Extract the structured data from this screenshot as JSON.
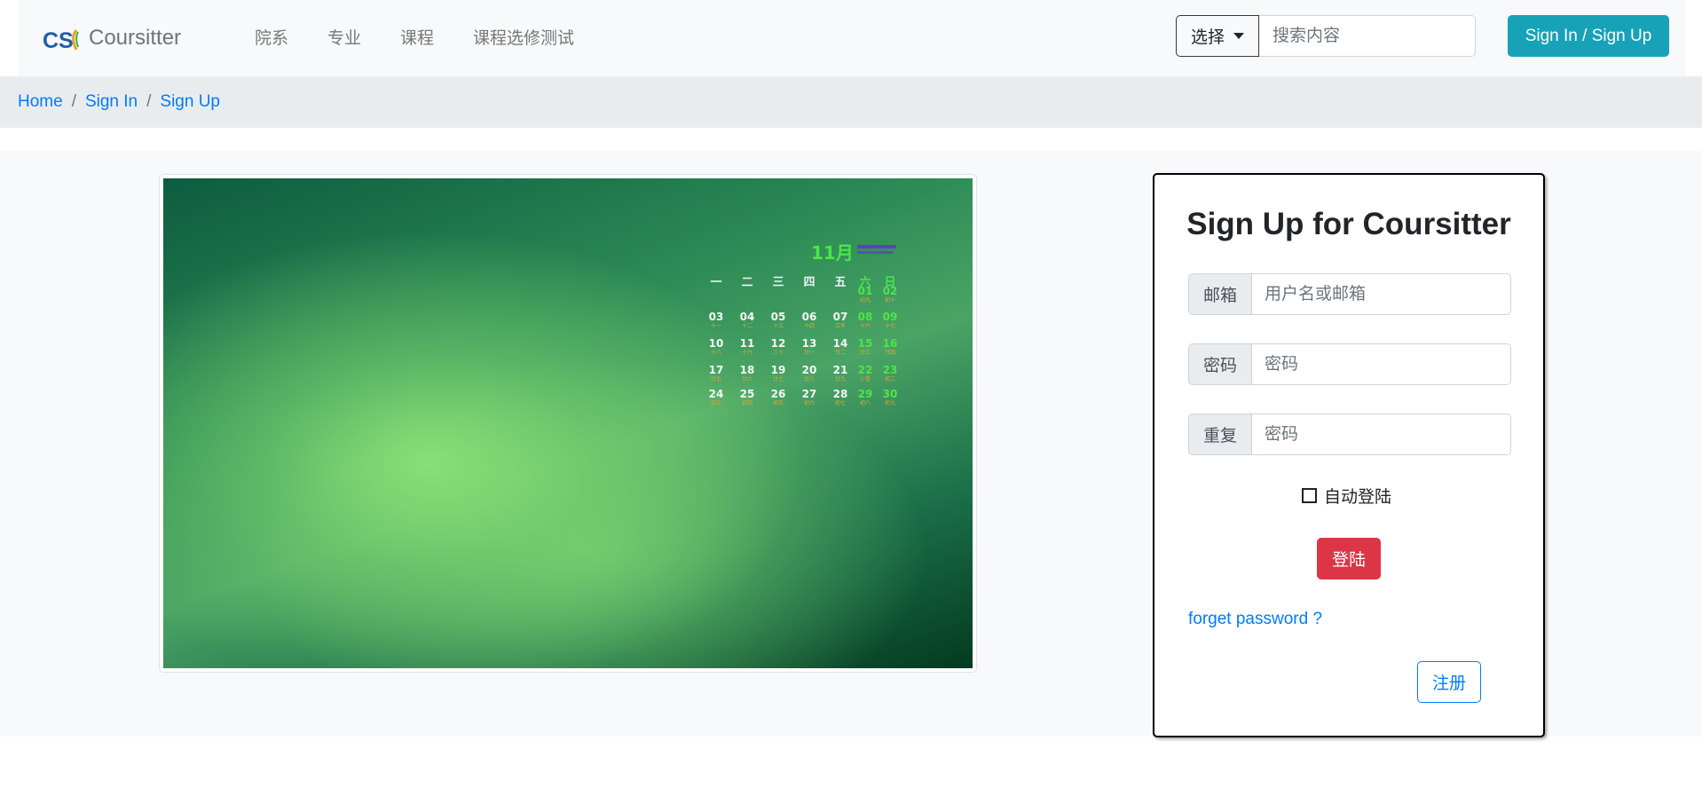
{
  "navbar": {
    "brand_text": "Coursitter",
    "links": [
      "院系",
      "专业",
      "课程",
      "课程选修测试"
    ],
    "search": {
      "select_label": "选择",
      "placeholder": "搜索内容"
    },
    "signin_label": "Sign In / Sign Up"
  },
  "breadcrumb": [
    "Home",
    "Sign In",
    "Sign Up"
  ],
  "calendar": {
    "month": "11月",
    "headers": [
      "一",
      "二",
      "三",
      "四",
      "五",
      "六",
      "日"
    ],
    "weeks": [
      [
        null,
        null,
        null,
        null,
        null,
        {
          "d": "01",
          "l": "初九"
        },
        {
          "d": "02",
          "l": "初十"
        }
      ],
      [
        {
          "d": "03",
          "l": "十一"
        },
        {
          "d": "04",
          "l": "十二"
        },
        {
          "d": "05",
          "l": "十三"
        },
        {
          "d": "06",
          "l": "十四"
        },
        {
          "d": "07",
          "l": "立冬"
        },
        {
          "d": "08",
          "l": "十六"
        },
        {
          "d": "09",
          "l": "十七"
        }
      ],
      [
        {
          "d": "10",
          "l": "十八"
        },
        {
          "d": "11",
          "l": "十九"
        },
        {
          "d": "12",
          "l": "二十"
        },
        {
          "d": "13",
          "l": "廿一"
        },
        {
          "d": "14",
          "l": "廿二"
        },
        {
          "d": "15",
          "l": "廿三"
        },
        {
          "d": "16",
          "l": "廿四"
        }
      ],
      [
        {
          "d": "17",
          "l": "廿五"
        },
        {
          "d": "18",
          "l": "廿六"
        },
        {
          "d": "19",
          "l": "廿七"
        },
        {
          "d": "20",
          "l": "廿八"
        },
        {
          "d": "21",
          "l": "廿九"
        },
        {
          "d": "22",
          "l": "小雪"
        },
        {
          "d": "23",
          "l": "初二"
        }
      ],
      [
        {
          "d": "24",
          "l": "初三"
        },
        {
          "d": "25",
          "l": "初四"
        },
        {
          "d": "26",
          "l": "初五"
        },
        {
          "d": "27",
          "l": "初六"
        },
        {
          "d": "28",
          "l": "初七"
        },
        {
          "d": "29",
          "l": "初八"
        },
        {
          "d": "30",
          "l": "初九"
        }
      ]
    ]
  },
  "signup": {
    "title": "Sign Up for Coursitter",
    "email_label": "邮箱",
    "email_placeholder": "用户名或邮箱",
    "password_label": "密码",
    "password_placeholder": "密码",
    "repeat_label": "重复",
    "repeat_placeholder": "密码",
    "remember_label": "自动登陆",
    "login_label": "登陆",
    "forgot_label": "forget password ?",
    "register_label": "注册"
  },
  "colors": {
    "brand_blue": "#007bff",
    "info": "#17a2b8",
    "danger": "#dc3545"
  }
}
